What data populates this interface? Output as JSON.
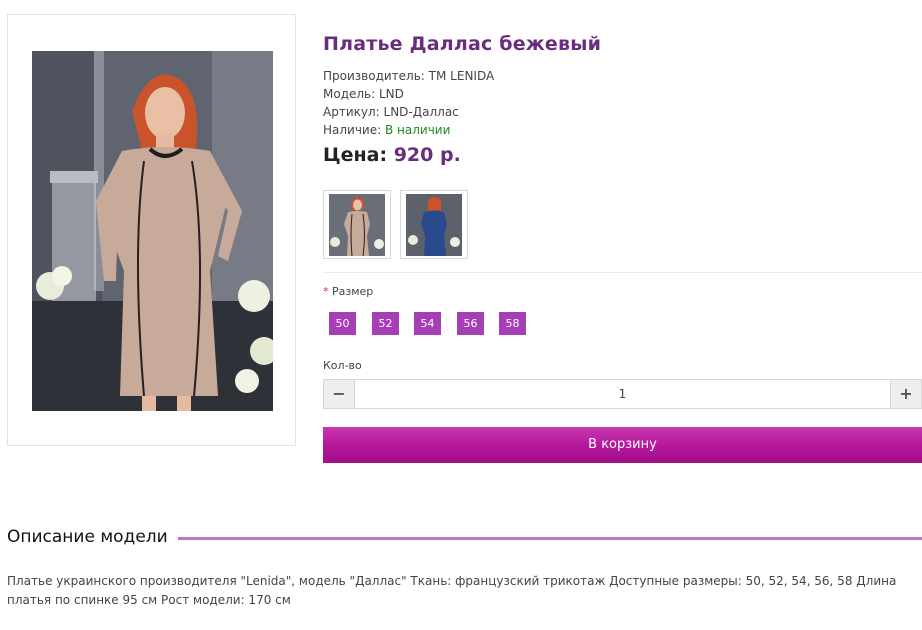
{
  "product": {
    "title": "Платье Даллас бежевый",
    "manufacturer_label": "Производитель:",
    "manufacturer": "TM LENIDA",
    "model_label": "Модель:",
    "model": "LND",
    "sku_label": "Артикул:",
    "sku": "LND-Даллас",
    "availability_label": "Наличие:",
    "availability": "В наличии",
    "price_label": "Цена:",
    "price": "920 р."
  },
  "options": {
    "size_required_mark": "*",
    "size_label": "Размер",
    "sizes": [
      "50",
      "52",
      "54",
      "56",
      "58"
    ]
  },
  "quantity": {
    "label": "Кол-во",
    "value": "1",
    "minus": "−",
    "plus": "+"
  },
  "cart_button": "В корзину",
  "description": {
    "heading": "Описание модели",
    "text": "Платье украинского производителя \"Lenida\", модель \"Даллас\" Ткань: французский трикотаж Доступные размеры: 50, 52, 54, 56, 58 Длина платья по спинке 95 см Рост модели: 170 см"
  },
  "colors": {
    "accent": "#6a2c7e",
    "size_button": "#a63fb5",
    "cart_button": "#b4169a",
    "in_stock": "#1e8a1e",
    "dress_beige": "#c7aa9a",
    "dress_blue": "#2a4a8c"
  }
}
